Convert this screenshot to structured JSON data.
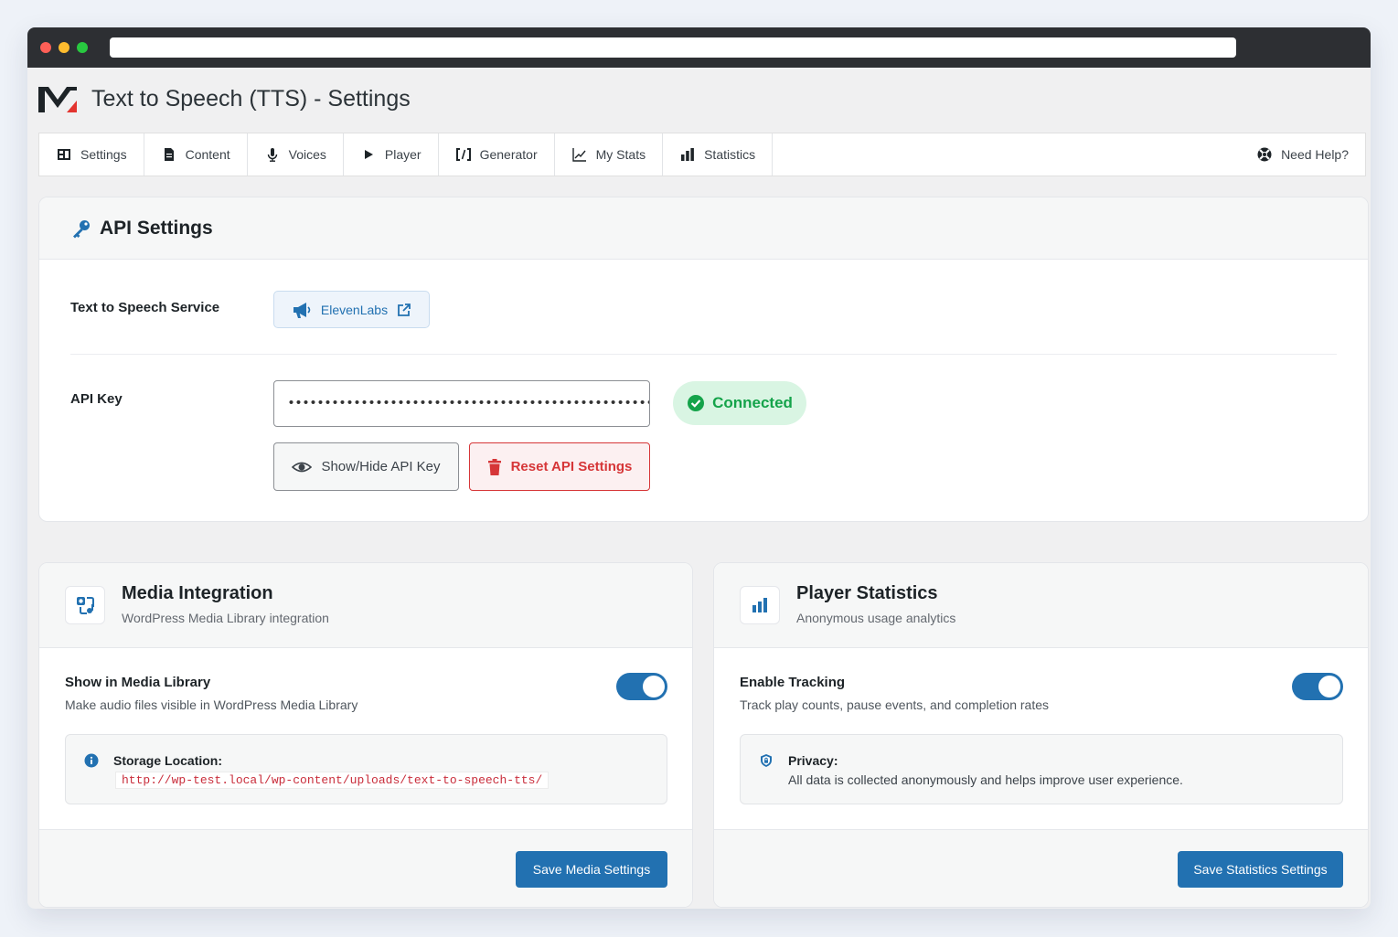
{
  "app": {
    "title": "Text to Speech (TTS) - Settings"
  },
  "tabs": [
    {
      "label": "Settings",
      "icon": "dashboard-icon"
    },
    {
      "label": "Content",
      "icon": "document-icon"
    },
    {
      "label": "Voices",
      "icon": "microphone-icon"
    },
    {
      "label": "Player",
      "icon": "play-icon"
    },
    {
      "label": "Generator",
      "icon": "code-icon"
    },
    {
      "label": "My Stats",
      "icon": "chart-line-icon"
    },
    {
      "label": "Statistics",
      "icon": "bar-chart-icon"
    }
  ],
  "help": {
    "label": "Need Help?",
    "icon": "lifebuoy-icon"
  },
  "api_settings": {
    "title": "API Settings",
    "service_label": "Text to Speech Service",
    "service_name": "ElevenLabs",
    "api_key_label": "API Key",
    "api_key_value": "••••••••••••••••••••••••••••••••••••••••••••••••••••••••••••••",
    "status": "Connected",
    "show_hide_label": "Show/Hide API Key",
    "reset_label": "Reset API Settings"
  },
  "media": {
    "title": "Media Integration",
    "subtitle": "WordPress Media Library integration",
    "option_title": "Show in Media Library",
    "option_desc": "Make audio files visible in WordPress Media Library",
    "toggle_on": true,
    "notice_label": "Storage Location:",
    "storage_path": "http://wp-test.local/wp-content/uploads/text-to-speech-tts/",
    "save_label": "Save Media Settings"
  },
  "stats": {
    "title": "Player Statistics",
    "subtitle": "Anonymous usage analytics",
    "option_title": "Enable Tracking",
    "option_desc": "Track play counts, pause events, and completion rates",
    "toggle_on": true,
    "notice_label": "Privacy:",
    "notice_text": "All data is collected anonymously and helps improve user experience.",
    "save_label": "Save Statistics Settings"
  },
  "colors": {
    "primary": "#2271b1",
    "danger": "#d63638",
    "success": "#14a34a",
    "logo_accent": "#e3342f"
  }
}
